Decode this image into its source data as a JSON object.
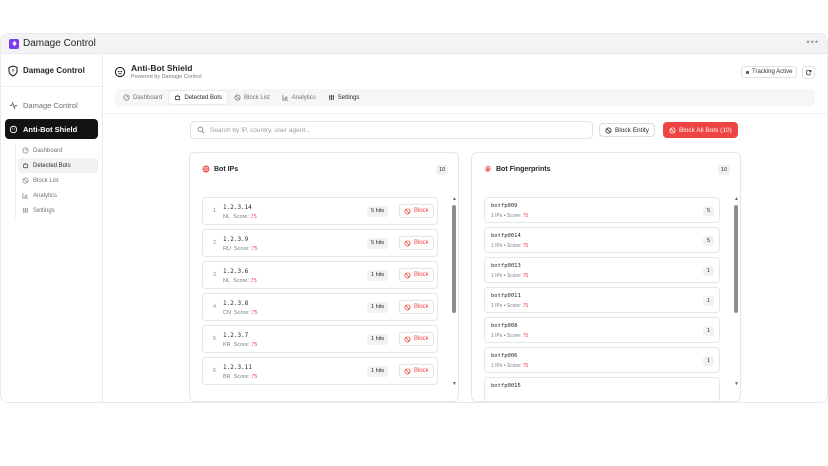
{
  "app": {
    "title": "Damage Control"
  },
  "sidebar": {
    "brand": "Damage Control",
    "items": [
      {
        "label": "Damage Control",
        "icon": "activity-icon"
      },
      {
        "label": "Anti-Bot Shield",
        "icon": "bot-icon",
        "active": true
      }
    ],
    "subitems": [
      {
        "label": "Dashboard",
        "icon": "dashboard-icon"
      },
      {
        "label": "Detected Bots",
        "icon": "bot-icon",
        "current": true
      },
      {
        "label": "Block List",
        "icon": "ban-icon"
      },
      {
        "label": "Analytics",
        "icon": "chart-icon"
      },
      {
        "label": "Settings",
        "icon": "sliders-icon"
      }
    ]
  },
  "header": {
    "title": "Anti-Bot Shield",
    "subtitle": "Powered by Damage Control",
    "tracking": "Tracking Active"
  },
  "tabs": [
    {
      "label": "Dashboard",
      "icon": "dashboard-icon"
    },
    {
      "label": "Detected Bots",
      "icon": "bot-icon",
      "active": true
    },
    {
      "label": "Block List",
      "icon": "ban-icon"
    },
    {
      "label": "Analytics",
      "icon": "chart-icon"
    },
    {
      "label": "Settings",
      "icon": "sliders-icon"
    }
  ],
  "search": {
    "placeholder": "Search by IP, country, user agent..."
  },
  "actions": {
    "block_entity": "Block Entity",
    "block_all": "Block All Bots (10)"
  },
  "colors": {
    "accent": "#ef4444",
    "brand": "#7c3aed",
    "active_nav": "#111315"
  },
  "bot_ips": {
    "title": "Bot IPs",
    "count": "10",
    "block_label": "Block",
    "rows": [
      {
        "idx": "1",
        "ip": "1.2.3.14",
        "country": "NL",
        "score_label": "Score:",
        "score": "75",
        "hits": "5 hits"
      },
      {
        "idx": "2",
        "ip": "1.2.3.9",
        "country": "RU",
        "score_label": "Score:",
        "score": "75",
        "hits": "5 hits"
      },
      {
        "idx": "3",
        "ip": "1.2.3.6",
        "country": "NL",
        "score_label": "Score:",
        "score": "75",
        "hits": "1 hits"
      },
      {
        "idx": "4",
        "ip": "1.2.3.8",
        "country": "CN",
        "score_label": "Score:",
        "score": "75",
        "hits": "1 hits"
      },
      {
        "idx": "5",
        "ip": "1.2.3.7",
        "country": "KR",
        "score_label": "Score:",
        "score": "75",
        "hits": "1 hits"
      },
      {
        "idx": "6",
        "ip": "1.2.3.11",
        "country": "BR",
        "score_label": "Score:",
        "score": "75",
        "hits": "1 hits"
      }
    ]
  },
  "bot_fingerprints": {
    "title": "Bot Fingerprints",
    "count": "10",
    "rows": [
      {
        "id": "botfp009",
        "meta": "1 IPs • Score:",
        "score": "75",
        "count": "5"
      },
      {
        "id": "botfp0014",
        "meta": "1 IPs • Score:",
        "score": "75",
        "count": "5"
      },
      {
        "id": "botfp0013",
        "meta": "1 IPs • Score:",
        "score": "75",
        "count": "1"
      },
      {
        "id": "botfp0011",
        "meta": "1 IPs • Score:",
        "score": "75",
        "count": "1"
      },
      {
        "id": "botfp008",
        "meta": "1 IPs • Score:",
        "score": "75",
        "count": "1"
      },
      {
        "id": "botfp006",
        "meta": "1 IPs • Score:",
        "score": "75",
        "count": "1"
      },
      {
        "id": "botfp0015",
        "meta": "",
        "score": "",
        "count": ""
      }
    ]
  }
}
